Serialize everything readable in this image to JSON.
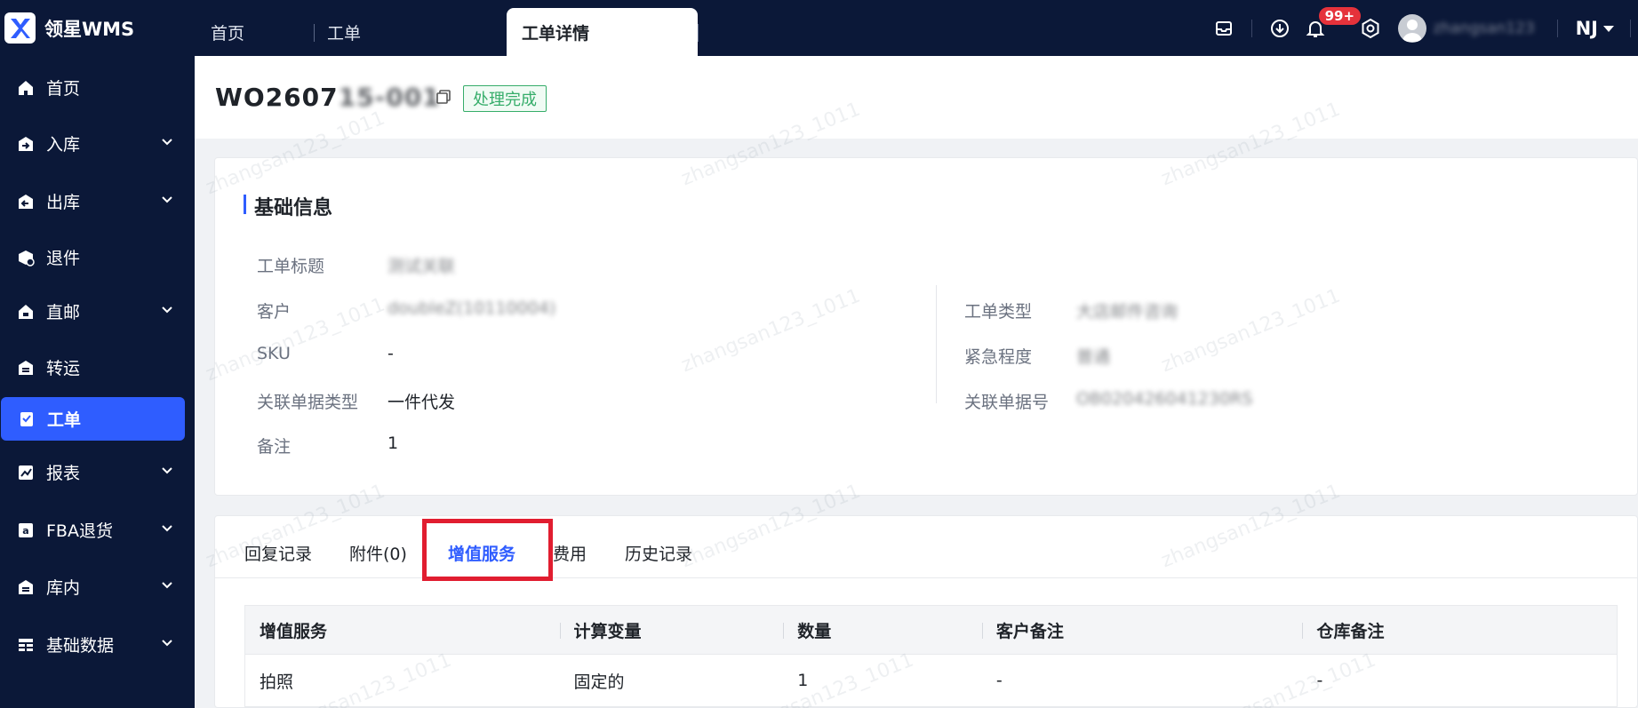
{
  "app": {
    "brand": "领星WMS"
  },
  "tabs": [
    {
      "label": "首页"
    },
    {
      "label": "工单"
    },
    {
      "label": "工单详情"
    }
  ],
  "topbar": {
    "notification_badge": "99+",
    "username": "zhangsan123",
    "warehouse": "NJ"
  },
  "sidebar": {
    "items": [
      {
        "label": "首页"
      },
      {
        "label": "入库"
      },
      {
        "label": "出库"
      },
      {
        "label": "退件"
      },
      {
        "label": "直邮"
      },
      {
        "label": "转运"
      },
      {
        "label": "工单"
      },
      {
        "label": "报表"
      },
      {
        "label": "FBA退货"
      },
      {
        "label": "库内"
      },
      {
        "label": "基础数据"
      }
    ]
  },
  "order": {
    "id_prefix": "WO2607",
    "id_suffix_blurred": "15-001",
    "status": "处理完成"
  },
  "basic_info": {
    "title": "基础信息",
    "fields": {
      "title_label": "工单标题",
      "title_value": "测试关联",
      "customer_label": "客户",
      "customer_value": "doubleZ(10110004)",
      "sku_label": "SKU",
      "sku_value": "-",
      "ref_type_label": "关联单据类型",
      "ref_type_value": "一件代发",
      "remark_label": "备注",
      "remark_value": "1",
      "type_label": "工单类型",
      "type_value": "大店邮件咨询",
      "urgency_label": "紧急程度",
      "urgency_value": "普通",
      "ref_no_label": "关联单据号",
      "ref_no_value": "OB020426041230RS"
    }
  },
  "detail_tabs": [
    {
      "label": "回复记录"
    },
    {
      "label": "附件(0)"
    },
    {
      "label": "增值服务"
    },
    {
      "label": "费用"
    },
    {
      "label": "历史记录"
    }
  ],
  "vas_table": {
    "headers": [
      "增值服务",
      "计算变量",
      "数量",
      "客户备注",
      "仓库备注"
    ],
    "rows": [
      [
        "拍照",
        "固定的",
        "1",
        "-",
        "-"
      ]
    ]
  },
  "watermark": "zhangsan123_1011",
  "colors": {
    "nav_bg": "#0b1838",
    "accent": "#2f5dff",
    "status_green": "#36ad6a",
    "highlight_red": "#e11d30"
  }
}
